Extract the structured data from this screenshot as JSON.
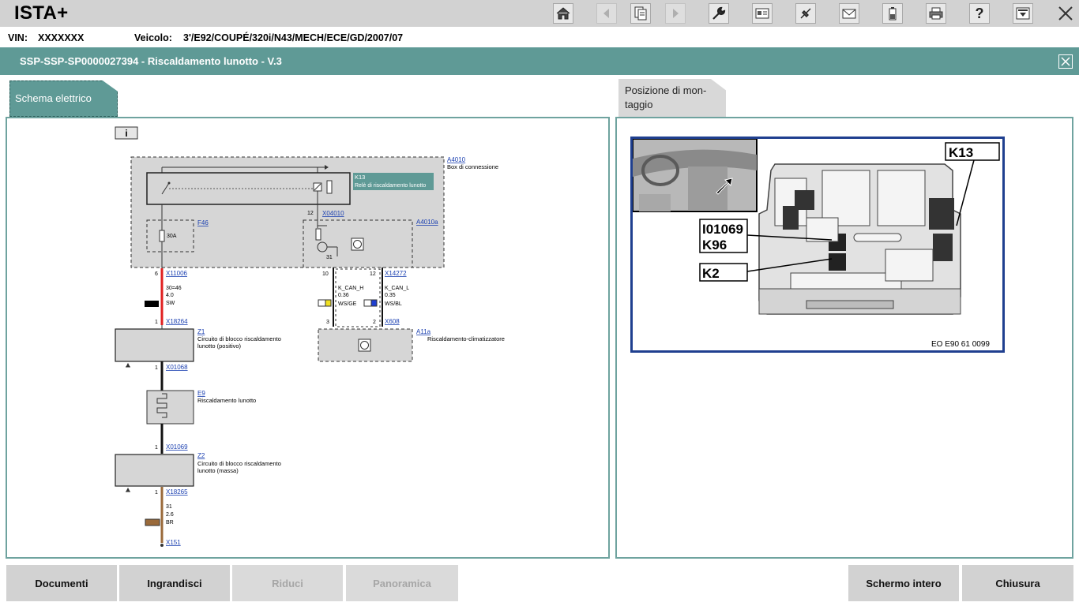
{
  "app": {
    "title": "ISTA+"
  },
  "vehicle": {
    "vin_label": "VIN:",
    "vin_value": "XXXXXXX",
    "vehicle_label": "Veicolo:",
    "vehicle_value": "3'/E92/COUPÉ/320i/N43/MECH/ECE/GD/2007/07"
  },
  "document": {
    "title": "SSP-SSP-SP0000027394  -  Riscaldamento lunotto  -  V.3"
  },
  "toolbar": {
    "icons": [
      "home-icon",
      "back-icon",
      "documents-icon",
      "forward-icon",
      "wrench-icon",
      "id-card-icon",
      "connector-icon",
      "mail-icon",
      "battery-icon",
      "printer-icon",
      "help-icon",
      "download-icon",
      "close-icon"
    ],
    "help_symbol": "?"
  },
  "tabs": {
    "schema": "Schema elettrico",
    "position": "Posizione di mon-taggio"
  },
  "wiring": {
    "info_symbol": "i",
    "box_id": "A4010",
    "box_name": "Box di connessione",
    "relay_id": "K13",
    "relay_name": "Relè di riscaldamento lunotto",
    "fuse_id": "F46",
    "fuse_value": "30A",
    "module_id": "A4010a",
    "conn_x04010": "X04010",
    "pin_12_top": "12",
    "pin_31": "31",
    "pin_6": "6",
    "conn_x11006": "X11006",
    "wire1_line1": "30=46",
    "wire1_line2": "4.0",
    "wire1_line3": "SW",
    "pin_1_a": "1",
    "conn_x18264": "X18264",
    "pin_10": "10",
    "pin_12_b": "12",
    "conn_x14272": "X14272",
    "can_h": "K_CAN_H",
    "can_h_size": "0.36",
    "can_h_color": "WS/GE",
    "can_l": "K_CAN_L",
    "can_l_size": "0.35",
    "can_l_color": "WS/BL",
    "pin_3": "3",
    "pin_2": "2",
    "conn_x608": "X608",
    "climate_id": "A11a",
    "climate_name": "Riscaldamento-climatizzatore",
    "z1_id": "Z1",
    "z1_line1": "Circuito di blocco riscaldamento",
    "z1_line2": "lunotto (positivo)",
    "pin_1_b": "1",
    "conn_x01068": "X01068",
    "e9_id": "E9",
    "e9_name": "Riscaldamento lunotto",
    "pin_1_c": "1",
    "conn_x01069": "X01069",
    "z2_id": "Z2",
    "z2_line1": "Circuito di blocco riscaldamento",
    "z2_line2": "lunotto (massa)",
    "pin_1_d": "1",
    "conn_x18265": "X18265",
    "wire2_line1": "31",
    "wire2_line2": "2.6",
    "wire2_line3": "BR",
    "conn_x151": "X151"
  },
  "mount_figure": {
    "label_k13": "K13",
    "label_i01069": "I01069",
    "label_k96": "K96",
    "label_k2": "K2",
    "caption": "EO E90 61 0099"
  },
  "buttons": {
    "documents": "Documenti",
    "zoom_in": "Ingrandisci",
    "zoom_out": "Riduci",
    "overview": "Panoramica",
    "fullscreen": "Schermo intero",
    "close": "Chiusura"
  },
  "colors": {
    "accent_teal": "#5f9a96",
    "wire_red": "#e02020",
    "wire_brown": "#9a6a3a",
    "link_blue": "#1a3fb0"
  }
}
